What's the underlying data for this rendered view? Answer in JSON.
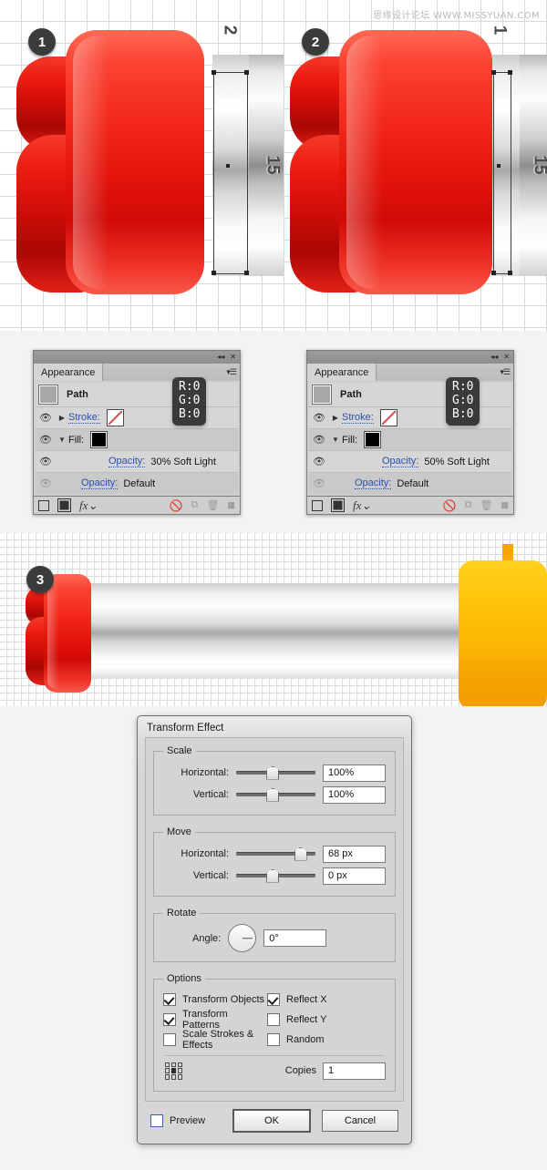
{
  "watermark": "思缘设计论坛  WWW.MISSYUAN.COM",
  "illustrations": {
    "step1": {
      "badge": "1",
      "labels": {
        "top": "2",
        "side": "15"
      }
    },
    "step2": {
      "badge": "2",
      "labels": {
        "top": "1",
        "side": "15"
      }
    },
    "step3": {
      "badge": "3"
    }
  },
  "panels": [
    {
      "title": "Appearance",
      "topbar": {
        "collapse_icon": "collapse-icon",
        "close_icon": "close-icon"
      },
      "menu_icon": "panel-menu-icon",
      "path_row": {
        "label": "Path",
        "thumb": "path-thumbnail"
      },
      "rows": [
        {
          "eye": "eye-icon",
          "triangle": "▶",
          "label": "Stroke:",
          "swatch": "stroke-none-swatch"
        },
        {
          "eye": "eye-icon",
          "triangle": "▼",
          "label": "Fill:",
          "swatch": "fill-black-swatch"
        }
      ],
      "opacity_row": {
        "label": "Opacity:",
        "value": "30% Soft Light"
      },
      "opacity_default_row": {
        "label": "Opacity:",
        "value": "Default"
      },
      "footer_icons": [
        "new-stroke-icon",
        "new-fill-icon",
        "fx-icon",
        "clear-appearance-icon",
        "duplicate-icon",
        "delete-icon",
        "resize-grip-icon"
      ],
      "tooltip": "R:0\nG:0\nB:0"
    },
    {
      "title": "Appearance",
      "topbar": {
        "collapse_icon": "collapse-icon",
        "close_icon": "close-icon"
      },
      "menu_icon": "panel-menu-icon",
      "path_row": {
        "label": "Path",
        "thumb": "path-thumbnail"
      },
      "rows": [
        {
          "eye": "eye-icon",
          "triangle": "▶",
          "label": "Stroke:",
          "swatch": "stroke-none-swatch"
        },
        {
          "eye": "eye-icon",
          "triangle": "▼",
          "label": "Fill:",
          "swatch": "fill-black-swatch"
        }
      ],
      "opacity_row": {
        "label": "Opacity:",
        "value": "50% Soft Light"
      },
      "opacity_default_row": {
        "label": "Opacity:",
        "value": "Default"
      },
      "footer_icons": [
        "new-stroke-icon",
        "new-fill-icon",
        "fx-icon",
        "clear-appearance-icon",
        "duplicate-icon",
        "delete-icon",
        "resize-grip-icon"
      ],
      "tooltip": "R:0\nG:0\nB:0"
    }
  ],
  "dialog": {
    "title": "Transform Effect",
    "scale": {
      "legend": "Scale",
      "horizontal": {
        "label": "Horizontal:",
        "value": "100%",
        "knob_pct": 45
      },
      "vertical": {
        "label": "Vertical:",
        "value": "100%",
        "knob_pct": 45
      }
    },
    "move": {
      "legend": "Move",
      "horizontal": {
        "label": "Horizontal:",
        "value": "68 px",
        "knob_pct": 80
      },
      "vertical": {
        "label": "Vertical:",
        "value": "0 px",
        "knob_pct": 45
      }
    },
    "rotate": {
      "legend": "Rotate",
      "angle": {
        "label": "Angle:",
        "value": "0°"
      }
    },
    "options": {
      "legend": "Options",
      "left": [
        {
          "label": "Transform Objects",
          "checked": true
        },
        {
          "label": "Transform Patterns",
          "checked": true
        },
        {
          "label": "Scale Strokes & Effects",
          "checked": false
        }
      ],
      "right": [
        {
          "label": "Reflect X",
          "checked": true
        },
        {
          "label": "Reflect Y",
          "checked": false
        },
        {
          "label": "Random",
          "checked": false
        }
      ],
      "copies": {
        "label": "Copies",
        "value": "1"
      }
    },
    "preview": {
      "label": "Preview",
      "checked": false
    },
    "buttons": {
      "ok": "OK",
      "cancel": "Cancel"
    }
  },
  "colors": {
    "red_highlight": "#ff6a55",
    "red_base": "#e4150c",
    "red_dark": "#a90704",
    "yellow": "#ffc40c",
    "panel_bg": "#d4d4d4",
    "link_blue": "#2a4fae",
    "badge_bg": "#3b3b3b"
  }
}
